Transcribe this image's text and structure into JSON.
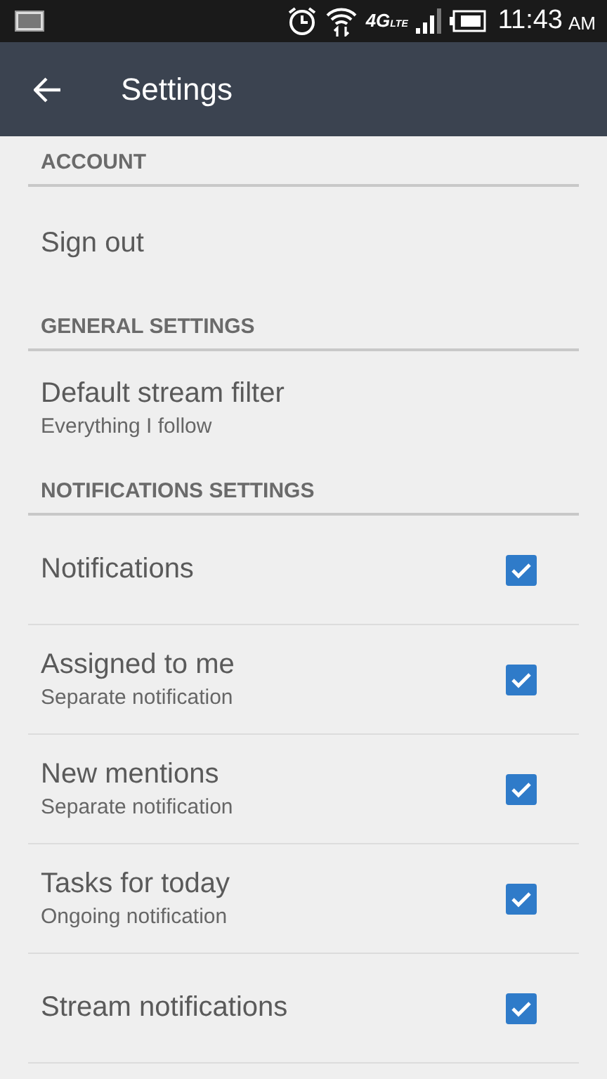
{
  "status_bar": {
    "network": "4G",
    "network_sub": "LTE",
    "time": "11:43",
    "period": "AM"
  },
  "app_bar": {
    "title": "Settings"
  },
  "sections": [
    {
      "title": "ACCOUNT",
      "items": [
        {
          "kind": "plain",
          "title": "Sign out"
        }
      ]
    },
    {
      "title": "GENERAL SETTINGS",
      "items": [
        {
          "kind": "plain",
          "title": "Default stream filter",
          "summary": "Everything I follow"
        }
      ]
    },
    {
      "title": "NOTIFICATIONS SETTINGS",
      "items": [
        {
          "kind": "checkbox",
          "title": "Notifications",
          "checked": true
        },
        {
          "kind": "checkbox",
          "title": "Assigned to me",
          "summary": "Separate notification",
          "checked": true
        },
        {
          "kind": "checkbox",
          "title": "New mentions",
          "summary": "Separate notification",
          "checked": true
        },
        {
          "kind": "checkbox",
          "title": "Tasks for today",
          "summary": "Ongoing notification",
          "checked": true
        },
        {
          "kind": "checkbox",
          "title": "Stream notifications",
          "checked": true
        }
      ]
    }
  ]
}
